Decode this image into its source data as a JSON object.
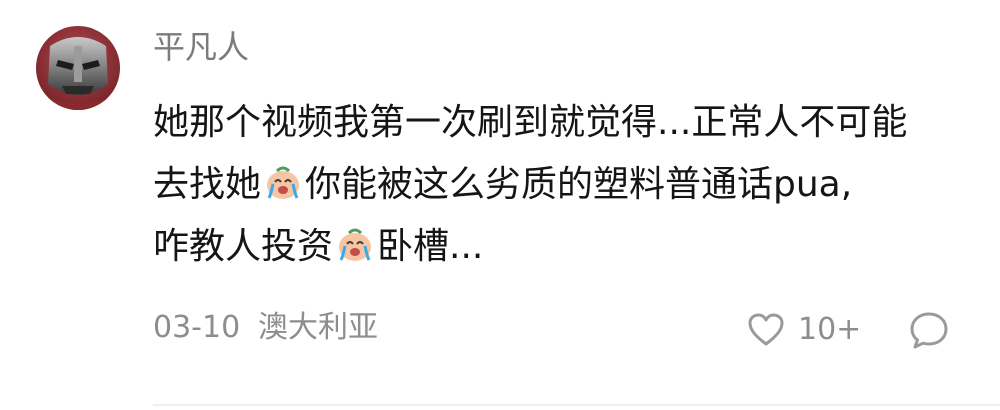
{
  "comment": {
    "username": "平凡人",
    "lines": [
      {
        "before": "她那个视频我第一次刷到就觉得...正常人不可能",
        "emoji": "",
        "after": ""
      },
      {
        "before": "去找她",
        "emoji": "crying-face",
        "after": "你能被这么劣质的塑料普通话pua,"
      },
      {
        "before": "咋教人投资",
        "emoji": "crying-face",
        "after": "卧槽..."
      }
    ],
    "date": "03-10",
    "location": "澳大利亚",
    "like_count": "10+",
    "icons": {
      "avatar": "iron-man-helmet-avatar",
      "like": "heart-icon",
      "reply": "comment-bubble-icon",
      "emoji": "crying-face-icon"
    },
    "colors": {
      "username": "#7b7b7b",
      "text": "#151515",
      "meta": "#8d8d8d",
      "icon_stroke": "#9a9a9a"
    }
  }
}
